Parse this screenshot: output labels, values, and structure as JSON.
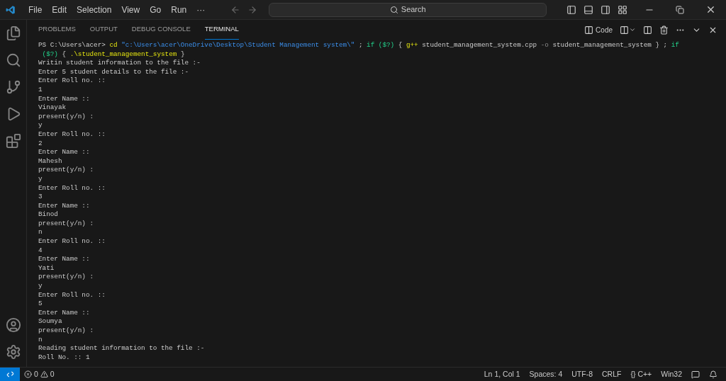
{
  "menu": [
    "File",
    "Edit",
    "Selection",
    "View",
    "Go",
    "Run",
    "···"
  ],
  "search": {
    "placeholder": "Search"
  },
  "panel": {
    "tabs": [
      {
        "label": "PROBLEMS",
        "selected": false
      },
      {
        "label": "OUTPUT",
        "selected": false
      },
      {
        "label": "DEBUG CONSOLE",
        "selected": false
      },
      {
        "label": "TERMINAL",
        "selected": true
      }
    ],
    "terminal_name": "Code"
  },
  "command_lines": [
    [
      {
        "kind": "plain",
        "text": "PS C:\\Users\\acer> "
      },
      {
        "kind": "command",
        "text": "cd"
      },
      {
        "kind": "string",
        "text": " \"c:\\Users\\acer\\OneDrive\\Desktop\\Student Management system\\\""
      },
      {
        "kind": "plain",
        "text": " ; "
      },
      {
        "kind": "keyword",
        "text": "if"
      },
      {
        "kind": "variable",
        "text": " ($?)"
      },
      {
        "kind": "plain",
        "text": " { "
      },
      {
        "kind": "command",
        "text": "g++"
      },
      {
        "kind": "plain",
        "text": " student_management_system.cpp "
      },
      {
        "kind": "flag",
        "text": "-o"
      },
      {
        "kind": "plain",
        "text": " student_management_system } ; "
      },
      {
        "kind": "keyword",
        "text": "if"
      }
    ],
    [
      {
        "kind": "variable",
        "text": " ($?)"
      },
      {
        "kind": "plain",
        "text": " { "
      },
      {
        "kind": "command",
        "text": ".\\student_management_system"
      },
      {
        "kind": "plain",
        "text": " }"
      }
    ]
  ],
  "output_lines": [
    "Writin student information to the file :-",
    "Enter 5 student details to the file :-",
    "Enter Roll no. ::",
    "1",
    "Enter Name ::",
    "Vinayak",
    "present(y/n) :",
    "y",
    "Enter Roll no. ::",
    "2",
    "Enter Name ::",
    "Mahesh",
    "present(y/n) :",
    "y",
    "Enter Roll no. ::",
    "3",
    "Enter Name ::",
    "Binod",
    "present(y/n) :",
    "n",
    "Enter Roll no. ::",
    "4",
    "Enter Name ::",
    "Yati",
    "present(y/n) :",
    "y",
    "Enter Roll no. ::",
    "5",
    "Enter Name ::",
    "Soumya",
    "present(y/n) :",
    "n",
    "Reading student information to the file :-",
    "Roll No. :: 1"
  ],
  "status_bar": {
    "errors": "0",
    "warnings": "0",
    "right": [
      "Ln 1, Col 1",
      "Spaces: 4",
      "UTF-8",
      "CRLF",
      "{} C++",
      "Win32"
    ]
  }
}
